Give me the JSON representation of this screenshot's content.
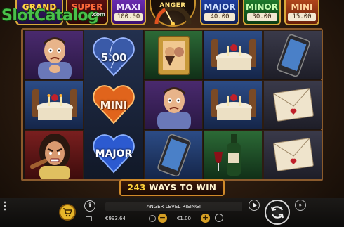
{
  "watermark": {
    "text": "SlotCatalog",
    "suffix": ".com"
  },
  "jackpots": {
    "grand": {
      "name": "GRAND",
      "value": ""
    },
    "super": {
      "name": "SUPER",
      "value": ""
    },
    "maxi": {
      "name": "MAXI",
      "value": "100.00"
    },
    "anger": {
      "name": "ANGER",
      "level_fraction": 0.35
    },
    "major": {
      "name": "MAJOR",
      "value": "40.00"
    },
    "minor": {
      "name": "MINOR",
      "value": "30.00"
    },
    "mini": {
      "name": "MINI",
      "value": "15.00"
    }
  },
  "reels": {
    "reel0": [
      "man-worried",
      "dinner-table",
      "angry-woman"
    ],
    "reel1": {
      "heart_value": "5.00",
      "heart_mini": "MINI",
      "heart_major": "MAJOR"
    },
    "reel2": [
      "photo-frame",
      "man-worried",
      "smartphone"
    ],
    "reel3": [
      "dinner-table",
      "dinner-table",
      "wine-bottle"
    ],
    "reel4": [
      "smartphone",
      "love-letter",
      "love-letter"
    ]
  },
  "ways": {
    "count": "243",
    "label": "WAYS TO WIN"
  },
  "controls": {
    "status": "ANGER LEVEL RISING!",
    "balance": "€993.64",
    "bet": "€1.00",
    "info": "i",
    "minus": "−",
    "plus": "+",
    "turbo": "»"
  },
  "colors": {
    "frame": "#8a5a2c",
    "gold": "#d59f24",
    "ways_border": "#d08a2a"
  }
}
